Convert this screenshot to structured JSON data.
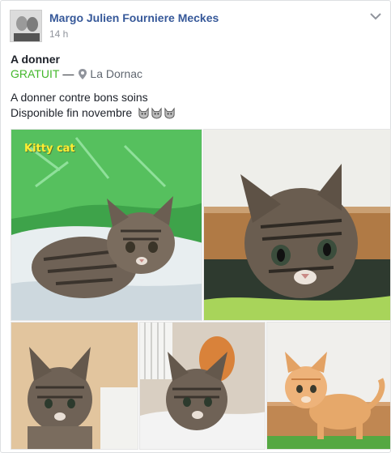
{
  "post": {
    "author": "Margo Julien Fourniere Meckes",
    "time": "14 h",
    "icons": {
      "menu": "chevron-down-icon",
      "location": "map-pin-icon",
      "emoji": "cat-face-emoji"
    }
  },
  "listing": {
    "title": "A donner",
    "price": "GRATUIT",
    "separator": "—",
    "location": "La Dornac",
    "description_line1": "A donner contre bons soins",
    "description_line2": "Disponible fin novembre",
    "price_color": "#42b72a"
  },
  "photos": {
    "count": 5,
    "caption1": "Kitty cat"
  },
  "colors": {
    "author_link": "#365899",
    "meta_gray": "#90949c"
  }
}
